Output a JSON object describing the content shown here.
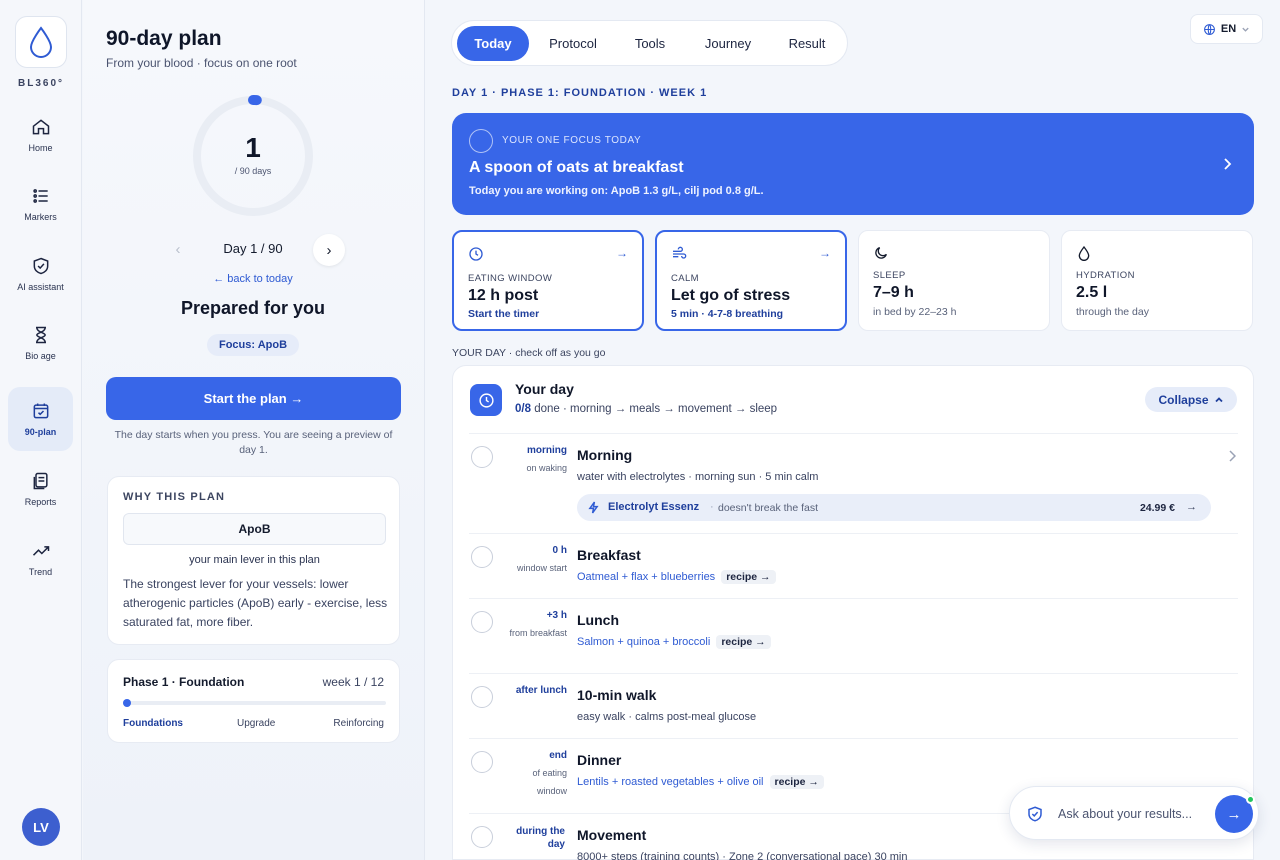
{
  "brand": {
    "logo_text": "BL360°"
  },
  "nav": [
    {
      "label": "Home",
      "icon": "home-icon"
    },
    {
      "label": "Markers",
      "icon": "list-icon"
    },
    {
      "label": "AI assistant",
      "icon": "shield-icon"
    },
    {
      "label": "Bio age",
      "icon": "hourglass-icon"
    },
    {
      "label": "90-plan",
      "icon": "calendar-check-icon",
      "active": true
    },
    {
      "label": "Reports",
      "icon": "document-icon"
    },
    {
      "label": "Trend",
      "icon": "trend-icon"
    }
  ],
  "user": {
    "initials": "LV"
  },
  "plan": {
    "title": "90-day plan",
    "subtitle": "From your blood · focus on one root",
    "day_number": "1",
    "days_total": "/ 90 days",
    "progress_fraction": 0.011,
    "day_label": "Day 1 / 90",
    "prev_glyph": "‹",
    "next_glyph": "›",
    "back_link": "← back to today",
    "heading": "Prepared for you",
    "focus_chip": "Focus: ApoB",
    "start_button": "Start the plan →",
    "start_note": "The day starts when you press. You are seeing a preview of day 1.",
    "why": {
      "heading": "WHY THIS PLAN",
      "marker": "ApoB",
      "lever": "your main lever in this plan",
      "text": "The strongest lever for your vessels: lower atherogenic particles (ApoB) early - exercise, less saturated fat, more fiber."
    },
    "phase": {
      "name": "Phase 1 · Foundation",
      "week": "week 1 / 12",
      "progress_fraction": 0.0,
      "stages": [
        "Foundations",
        "Upgrade",
        "Reinforcing"
      ]
    }
  },
  "tabs": [
    {
      "label": "Today",
      "active": true
    },
    {
      "label": "Protocol"
    },
    {
      "label": "Tools"
    },
    {
      "label": "Journey"
    },
    {
      "label": "Result"
    }
  ],
  "language": {
    "label": "EN",
    "icon": "globe-icon"
  },
  "breadcrumb": "DAY 1 · PHASE 1: FOUNDATION · WEEK 1",
  "focus": {
    "label": "YOUR ONE FOCUS TODAY",
    "title": "A spoon of oats at breakfast",
    "subtitle": "Today you are working on: ApoB 1.3 g/L, cilj pod 0.8 g/L."
  },
  "cards": [
    {
      "label": "EATING WINDOW",
      "value": "12 h post",
      "note": "Start the timer",
      "icon": "clock-icon",
      "highlight": true,
      "arrow": "→"
    },
    {
      "label": "CALM",
      "value": "Let go of stress",
      "note": "5 min · 4-7-8 breathing",
      "icon": "wind-icon",
      "highlight": true,
      "arrow": "→"
    },
    {
      "label": "SLEEP",
      "value": "7–9 h",
      "note": "in bed by 22–23 h",
      "icon": "moon-icon",
      "highlight": false
    },
    {
      "label": "HYDRATION",
      "value": "2.5 l",
      "note": "through the day",
      "icon": "drop-icon",
      "highlight": false
    }
  ],
  "your_day_caption": {
    "strong": "YOUR DAY",
    "rest": " · check off as you go"
  },
  "day": {
    "title": "Your day",
    "progress": "0/8",
    "progress_rest": " done · morning → meals → movement → sleep",
    "collapse": "Collapse",
    "recipe_label": "recipe →",
    "items": [
      {
        "time": "morning",
        "time_sub": "on waking",
        "name": "Morning",
        "desc": "water with electrolytes · morning sun · 5 min calm",
        "product": {
          "name": "Electrolyt Essenz",
          "note": "doesn't break the fast",
          "price": "24.99 €"
        }
      },
      {
        "time": "0 h",
        "time_sub": "window start",
        "name": "Breakfast",
        "desc": "Oatmeal + flax + blueberries",
        "recipe": true
      },
      {
        "time": "+3 h",
        "time_sub": "from breakfast",
        "name": "Lunch",
        "desc": "Salmon + quinoa + broccoli",
        "recipe": true
      },
      {
        "time": "after lunch",
        "time_sub": "",
        "name": "10-min walk",
        "desc": "easy walk · calms post-meal glucose"
      },
      {
        "time": "end",
        "time_sub": "of eating window",
        "name": "Dinner",
        "desc": "Lentils + roasted vegetables + olive oil",
        "recipe": true
      },
      {
        "time": "during the day",
        "time_sub": "",
        "name": "Movement",
        "desc": "8000+ steps (training counts) · Zone 2 (conversational pace) 30 min"
      }
    ]
  },
  "ask": {
    "placeholder": "Ask about your results...",
    "send": "→"
  },
  "colors": {
    "accent": "#3866e8",
    "accent_dark": "#1f3f9c",
    "online": "#22c55e"
  }
}
